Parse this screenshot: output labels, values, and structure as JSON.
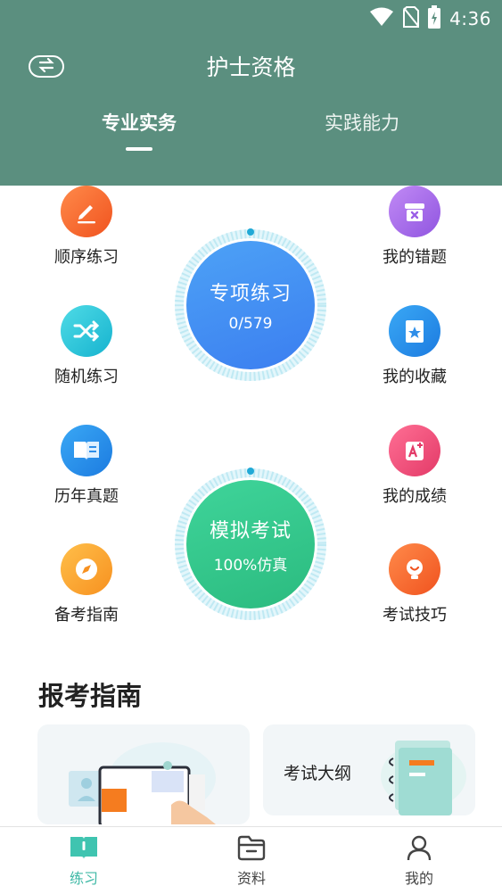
{
  "status_bar": {
    "time": "4:36",
    "icons": [
      "wifi-icon",
      "no-sim-icon",
      "battery-charging-icon"
    ]
  },
  "header": {
    "title": "护士资格",
    "switch_icon": "swap-icon",
    "tabs": [
      {
        "label": "专业实务",
        "active": true
      },
      {
        "label": "实践能力",
        "active": false
      }
    ],
    "bg_color": "#5b8f7f"
  },
  "features": {
    "left": [
      {
        "label": "顺序练习",
        "icon": "pencil-icon",
        "color": "#f56a2c"
      },
      {
        "label": "随机练习",
        "icon": "shuffle-icon",
        "color": "#28c4d8"
      },
      {
        "label": "历年真题",
        "icon": "book-icon",
        "color": "#2f8ee8"
      },
      {
        "label": "备考指南",
        "icon": "compass-icon",
        "color": "#f9a12b"
      }
    ],
    "right": [
      {
        "label": "我的错题",
        "icon": "wrong-box-icon",
        "color": "#a468e6"
      },
      {
        "label": "我的收藏",
        "icon": "star-bookmark-icon",
        "color": "#2f8ee8"
      },
      {
        "label": "我的成绩",
        "icon": "grade-icon",
        "color": "#ee4e79"
      },
      {
        "label": "考试技巧",
        "icon": "lightbulb-icon",
        "color": "#f56a2c"
      }
    ]
  },
  "practice_circle": {
    "title": "专项练习",
    "progress": "0/579"
  },
  "exam_circle": {
    "title": "模拟考试",
    "subtitle": "100%仿真"
  },
  "guide": {
    "title": "报考指南",
    "cards": [
      {
        "label": "",
        "illustration": "computer-illustration"
      },
      {
        "label": "考试大纲",
        "illustration": "notebook-illustration"
      }
    ]
  },
  "bottom_nav": [
    {
      "label": "练习",
      "icon": "book-open-icon",
      "active": true
    },
    {
      "label": "资料",
      "icon": "folder-icon",
      "active": false
    },
    {
      "label": "我的",
      "icon": "user-icon",
      "active": false
    }
  ]
}
